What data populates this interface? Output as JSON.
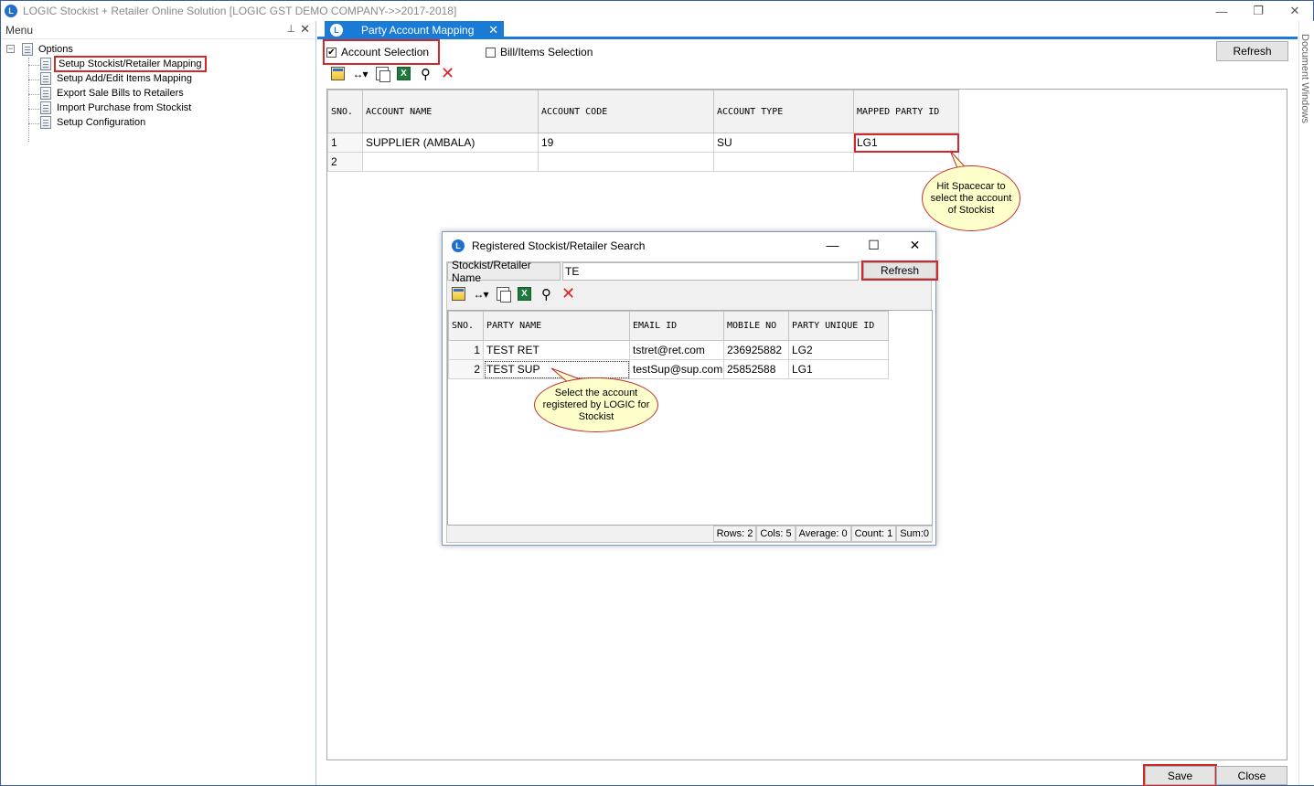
{
  "window": {
    "title": "LOGIC Stockist + Retailer Online Solution [LOGIC GST DEMO COMPANY->>2017-2018]",
    "app_icon_letter": "L"
  },
  "menu": {
    "header": "Menu",
    "root_label": "Options",
    "items": [
      {
        "label": "Setup Stockist/Retailer Mapping"
      },
      {
        "label": "Setup Add/Edit Items Mapping"
      },
      {
        "label": "Export Sale Bills to Retailers"
      },
      {
        "label": "Import Purchase from Stockist"
      },
      {
        "label": "Setup Configuration"
      }
    ]
  },
  "tab": {
    "label": "Party Account Mapping",
    "icon_letter": "L"
  },
  "side_panel": {
    "label": "Document Windows"
  },
  "options": {
    "account_selection": {
      "label": "Account Selection",
      "checked": true,
      "mark": "✔"
    },
    "bill_items_selection": {
      "label": "Bill/Items Selection",
      "checked": false
    },
    "refresh_label": "Refresh"
  },
  "main_grid": {
    "columns": [
      "SNO.",
      "ACCOUNT NAME",
      "ACCOUNT CODE",
      "ACCOUNT TYPE",
      "MAPPED PARTY ID"
    ],
    "rows": [
      {
        "sno": "1",
        "account_name": "SUPPLIER (AMBALA)",
        "account_code": "19",
        "account_type": "SU",
        "mapped_party_id": "LG1"
      },
      {
        "sno": "2",
        "account_name": "",
        "account_code": "",
        "account_type": "",
        "mapped_party_id": ""
      }
    ]
  },
  "callout_main": {
    "text": "Hit Spacecar to select the account of Stockist"
  },
  "dialog": {
    "title": "Registered Stockist/Retailer Search",
    "search_label": "Stockist/Retailer Name",
    "search_value": "TE",
    "refresh_label": "Refresh",
    "columns": [
      "SNO.",
      "PARTY NAME",
      "EMAIL ID",
      "MOBILE NO",
      "PARTY UNIQUE ID"
    ],
    "rows": [
      {
        "sno": "1",
        "party_name": "TEST RET",
        "email": "tstret@ret.com",
        "mobile": "236925882",
        "uid": "LG2"
      },
      {
        "sno": "2",
        "party_name": "TEST SUP",
        "email": "testSup@sup.com",
        "mobile": "25852588",
        "uid": "LG1"
      }
    ],
    "status": {
      "rows": "Rows: 2",
      "cols": "Cols: 5",
      "average": "Average: 0",
      "count": "Count: 1",
      "sum": "Sum:0"
    }
  },
  "callout_dialog": {
    "text": "Select the account registered by LOGIC for Stockist"
  },
  "footer": {
    "save_label": "Save",
    "close_label": "Close"
  },
  "icons": {
    "minimize": "—",
    "restore": "❐",
    "close": "✕",
    "pin": "⊥",
    "dlg_minimize": "—",
    "dlg_maximize": "☐",
    "dlg_close": "✕",
    "expander": "−"
  },
  "colors": {
    "accent": "#1a7bd6",
    "highlight_red": "#d12929",
    "callout_bg": "#ffffcc"
  }
}
